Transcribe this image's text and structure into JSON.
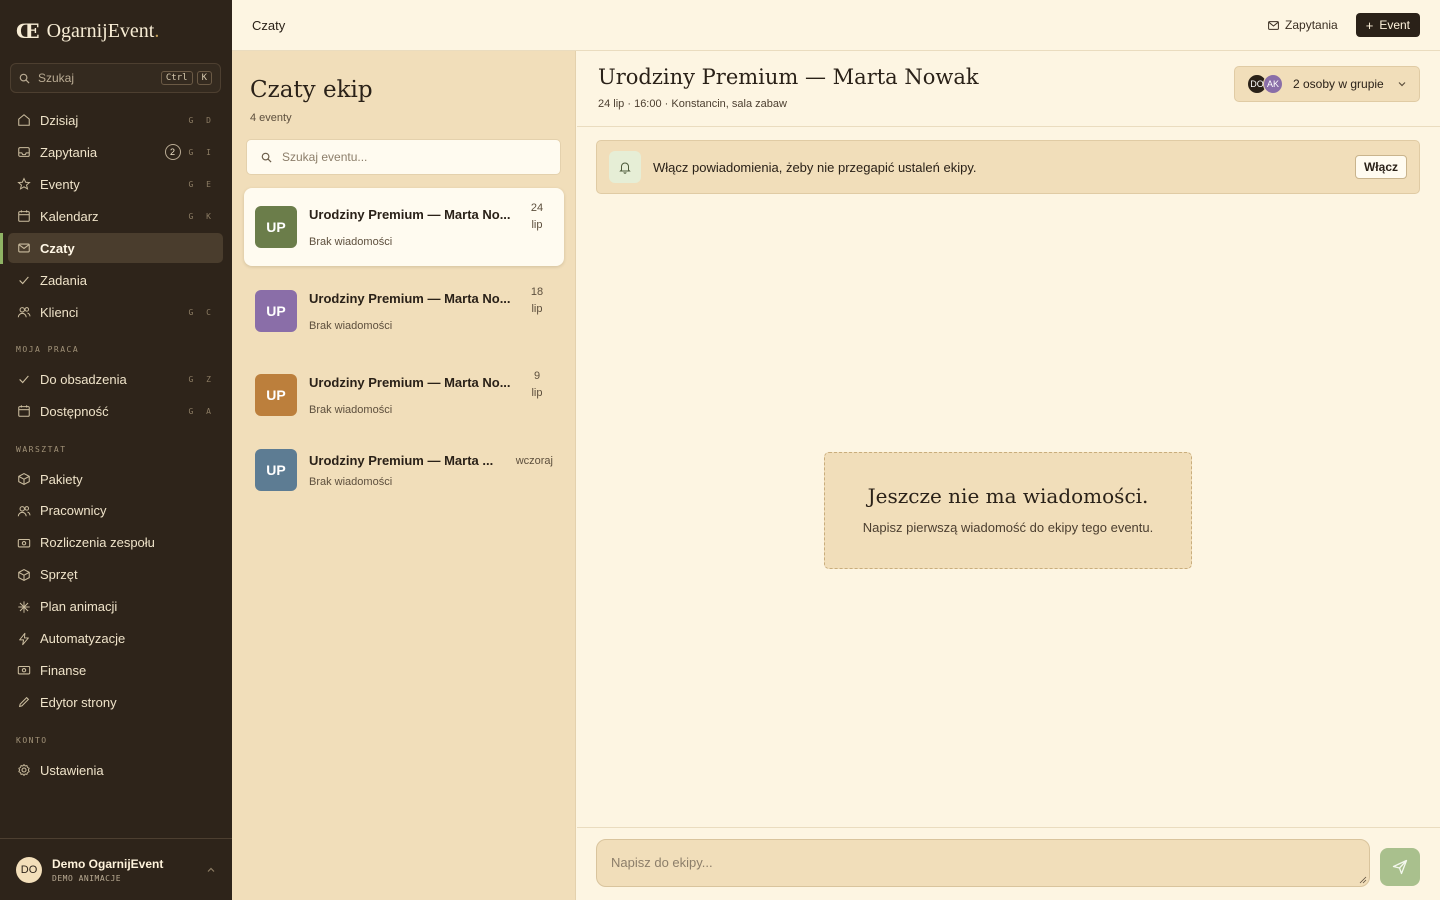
{
  "app": {
    "logo_mark": "Œ",
    "name": "OgarnijEvent",
    "dot": "."
  },
  "sidebar": {
    "search": {
      "placeholder": "Szukaj",
      "kbd1": "Ctrl",
      "kbd2": "K"
    },
    "main_items": [
      {
        "label": "Dzisiaj",
        "hint": "G D",
        "icon": "home-icon"
      },
      {
        "label": "Zapytania",
        "hint": "G I",
        "badge": "2",
        "icon": "inbox-icon"
      },
      {
        "label": "Eventy",
        "hint": "G E",
        "icon": "star-icon"
      },
      {
        "label": "Kalendarz",
        "hint": "G K",
        "icon": "calendar-icon"
      },
      {
        "label": "Czaty",
        "hint": "",
        "icon": "mail-icon",
        "active": true
      },
      {
        "label": "Zadania",
        "hint": "",
        "icon": "check-icon"
      },
      {
        "label": "Klienci",
        "hint": "G C",
        "icon": "users-icon"
      }
    ],
    "section_work": "MOJA PRACA",
    "work_items": [
      {
        "label": "Do obsadzenia",
        "hint": "G Z",
        "icon": "check-icon"
      },
      {
        "label": "Dostępność",
        "hint": "G A",
        "icon": "calendar-icon"
      }
    ],
    "section_workshop": "WARSZTAT",
    "workshop_items": [
      {
        "label": "Pakiety",
        "icon": "package-icon"
      },
      {
        "label": "Pracownicy",
        "icon": "users-icon"
      },
      {
        "label": "Rozliczenia zespołu",
        "icon": "money-icon"
      },
      {
        "label": "Sprzęt",
        "icon": "package-icon"
      },
      {
        "label": "Plan animacji",
        "icon": "sparkle-icon"
      },
      {
        "label": "Automatyzacje",
        "icon": "bolt-icon"
      },
      {
        "label": "Finanse",
        "icon": "money-icon"
      },
      {
        "label": "Edytor strony",
        "icon": "pencil-icon"
      }
    ],
    "section_account": "KONTO",
    "account_items": [
      {
        "label": "Ustawienia",
        "icon": "gear-icon"
      }
    ],
    "user": {
      "initials": "DO",
      "name": "Demo OgarnijEvent",
      "role": "DEMO ANIMACJE"
    }
  },
  "topbar": {
    "breadcrumb": "Czaty",
    "inquiries_label": "Zapytania",
    "new_event_label": "Event"
  },
  "chat_list": {
    "title": "Czaty ekip",
    "count": "4 eventy",
    "search_placeholder": "Szukaj eventu...",
    "items": [
      {
        "initials": "UP",
        "title": "Urodziny Premium — Marta No...",
        "subtitle": "Brak wiadomości",
        "date_line1": "24",
        "date_line2": "lip",
        "color": "#6b7d4a",
        "selected": true
      },
      {
        "initials": "UP",
        "title": "Urodziny Premium — Marta No...",
        "subtitle": "Brak wiadomości",
        "date_line1": "18",
        "date_line2": "lip",
        "color": "#8a6ea8"
      },
      {
        "initials": "UP",
        "title": "Urodziny Premium — Marta No...",
        "subtitle": "Brak wiadomości",
        "date_line1": "9",
        "date_line2": "lip",
        "color": "#bc7f3c"
      },
      {
        "initials": "UP",
        "title": "Urodziny Premium — Marta ...",
        "subtitle": "Brak wiadomości",
        "date_line1": "wczoraj",
        "date_line2": "",
        "color": "#5d7c93"
      }
    ]
  },
  "conversation": {
    "title": "Urodziny Premium — Marta Nowak",
    "subtitle": "24 lip · 16:00 · Konstancin, sala zabaw",
    "members": {
      "avatar1": "DO",
      "avatar2": "AK",
      "label": "2 osoby w grupie"
    },
    "notification": {
      "text": "Włącz powiadomienia, żeby nie przegapić ustaleń ekipy.",
      "button": "Włącz"
    },
    "empty": {
      "title": "Jeszcze nie ma wiadomości.",
      "subtitle": "Napisz pierwszą wiadomość do ekipy tego eventu."
    },
    "composer_placeholder": "Napisz do ekipy..."
  },
  "colors": {
    "sidebar_bg": "#2e241a",
    "accent_green": "#8fb364",
    "send_button": "#a9c08d",
    "panel_bg": "#f1deba",
    "page_bg": "#fdf5e2"
  }
}
